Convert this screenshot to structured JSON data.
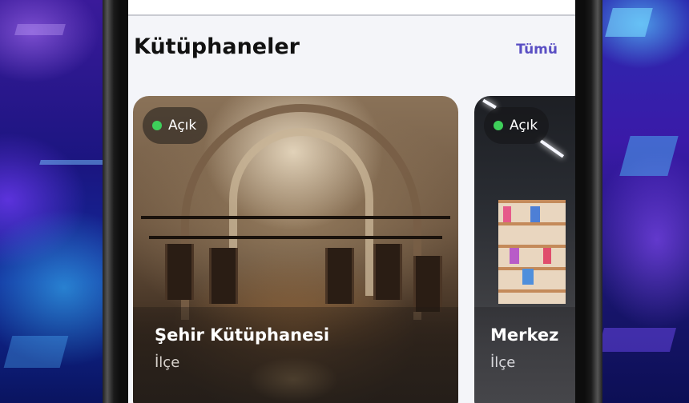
{
  "section": {
    "title": "Kütüphaneler",
    "see_all_label": "Tümü"
  },
  "libraries": [
    {
      "name": "Şehir Kütüphanesi",
      "district": "İlçe",
      "status": "Açık",
      "status_color": "#3ecf5a"
    },
    {
      "name": "Merkez",
      "district": "İlçe",
      "status": "Açık",
      "status_color": "#3ecf5a"
    }
  ],
  "colors": {
    "accent": "#5a4fc4",
    "screen_background": "#f4f5f9",
    "title_text": "#111111"
  }
}
